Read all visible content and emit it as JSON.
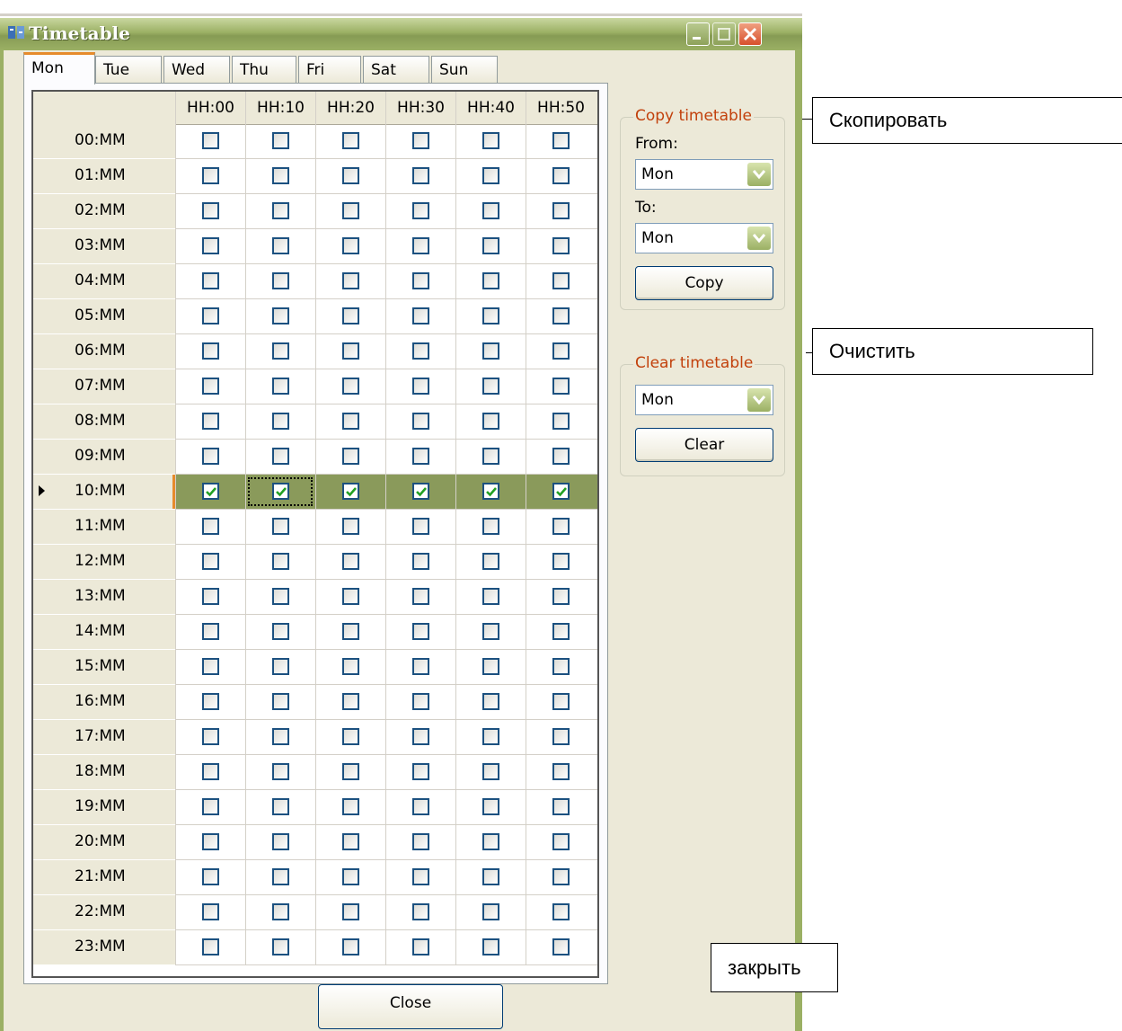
{
  "window": {
    "title": "Timetable",
    "close_label": "Close"
  },
  "tabs": [
    {
      "label": "Mon",
      "active": true
    },
    {
      "label": "Tue",
      "active": false
    },
    {
      "label": "Wed",
      "active": false
    },
    {
      "label": "Thu",
      "active": false
    },
    {
      "label": "Fri",
      "active": false
    },
    {
      "label": "Sat",
      "active": false
    },
    {
      "label": "Sun",
      "active": false
    }
  ],
  "grid": {
    "columns": [
      "HH:00",
      "HH:10",
      "HH:20",
      "HH:30",
      "HH:40",
      "HH:50"
    ],
    "rows": [
      "00:MM",
      "01:MM",
      "02:MM",
      "03:MM",
      "04:MM",
      "05:MM",
      "06:MM",
      "07:MM",
      "08:MM",
      "09:MM",
      "10:MM",
      "11:MM",
      "12:MM",
      "13:MM",
      "14:MM",
      "15:MM",
      "16:MM",
      "17:MM",
      "18:MM",
      "19:MM",
      "20:MM",
      "21:MM",
      "22:MM",
      "23:MM"
    ],
    "selected_row": "10:MM",
    "checked_rows": [
      "10:MM"
    ],
    "focused_cell": {
      "row": "10:MM",
      "column": "HH:10"
    }
  },
  "copy_group": {
    "legend": "Copy timetable",
    "from_label": "From:",
    "from_value": "Mon",
    "to_label": "To:",
    "to_value": "Mon",
    "button": "Copy"
  },
  "clear_group": {
    "legend": "Clear timetable",
    "value": "Mon",
    "button": "Clear"
  },
  "annotations": {
    "copy": "Скопировать",
    "clear": "Очистить",
    "close": "закрыть"
  },
  "colors": {
    "title_bar": "#9bb064",
    "checked_row": "#8a9a5b",
    "legend_text": "#c2410c",
    "tab_accent": "#e68b2c"
  }
}
